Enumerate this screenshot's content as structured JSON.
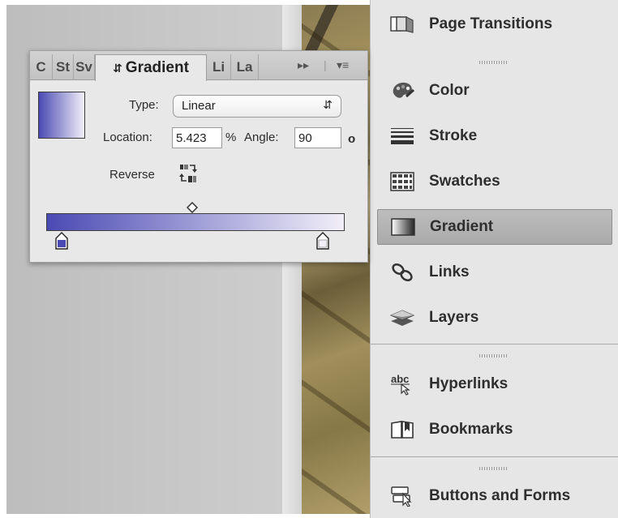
{
  "gradient_panel": {
    "tabs": [
      {
        "label": "C"
      },
      {
        "label": "St"
      },
      {
        "label": "Sv"
      },
      {
        "label": "Gradient"
      },
      {
        "label": "Li"
      },
      {
        "label": "La"
      }
    ],
    "active_tab_icon": "updown-arrows-icon",
    "type_label": "Type:",
    "type_value": "Linear",
    "location_label": "Location:",
    "location_value": "5.423",
    "location_unit": "%",
    "angle_label": "Angle:",
    "angle_value": "90",
    "angle_unit": "o",
    "reverse_label": "Reverse",
    "colors": {
      "start": "#4a4ab4",
      "end": "#f2eff8"
    }
  },
  "dock": {
    "items": [
      {
        "label": "Page Transitions",
        "icon": "page-transitions-icon"
      },
      {
        "label": "Color",
        "icon": "color-palette-icon"
      },
      {
        "label": "Stroke",
        "icon": "stroke-icon"
      },
      {
        "label": "Swatches",
        "icon": "swatches-icon"
      },
      {
        "label": "Gradient",
        "icon": "gradient-icon",
        "active": true
      },
      {
        "label": "Links",
        "icon": "links-icon"
      },
      {
        "label": "Layers",
        "icon": "layers-icon"
      },
      {
        "label": "Hyperlinks",
        "icon": "hyperlinks-icon"
      },
      {
        "label": "Bookmarks",
        "icon": "bookmarks-icon"
      },
      {
        "label": "Buttons and Forms",
        "icon": "buttons-forms-icon"
      }
    ]
  }
}
